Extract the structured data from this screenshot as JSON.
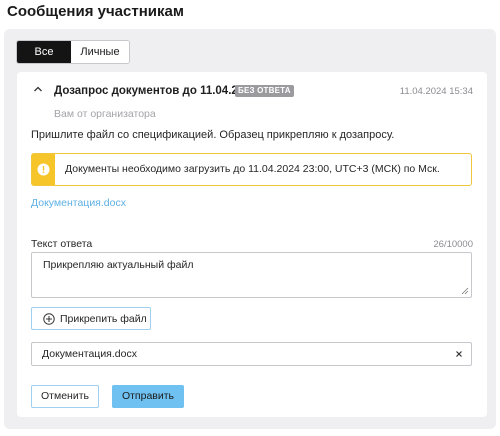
{
  "page": {
    "title": "Сообщения участникам"
  },
  "tabs": [
    {
      "label": "Все",
      "active": true
    },
    {
      "label": "Личные",
      "active": false
    }
  ],
  "message": {
    "title": "Дозапрос документов до 11.04.2024",
    "badge": "БЕЗ ОТВЕТА",
    "timestamp": "11.04.2024 15:34",
    "sender": "Вам от организатора",
    "body": "Пришлите файл со спецификацией. Образец прикрепляю к дозапросу.",
    "alert": {
      "icon": "exclamation-icon",
      "text": "Документы необходимо загрузить до 11.04.2024 23:00, UTC+3 (МСК) по Мск.",
      "color": "#f6c52a"
    },
    "attachment": "Документация.docx"
  },
  "reply": {
    "label": "Текст ответа",
    "counter": "26/10000",
    "value": "Прикрепляю актуальный файл",
    "attach_button": "Прикрепить файл",
    "attached_file": "Документация.docx",
    "cancel_button": "Отменить",
    "submit_button": "Отправить"
  },
  "colors": {
    "accent": "#6ec1f0",
    "link": "#5db0e6",
    "warning": "#f6c52a",
    "badge": "#9a9a9f"
  }
}
